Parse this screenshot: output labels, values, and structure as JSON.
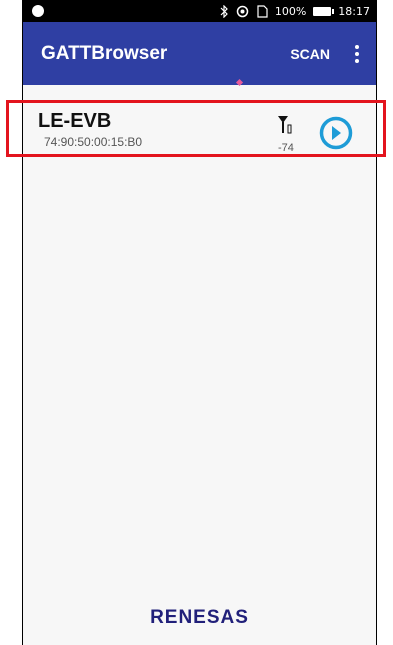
{
  "status_bar": {
    "battery_percent": "100%",
    "time": "18:17"
  },
  "app_bar": {
    "title": "GATTBrowser",
    "scan_label": "SCAN"
  },
  "devices": [
    {
      "name": "LE-EVB",
      "mac": "74:90:50:00:15:B0",
      "rssi": "-74"
    }
  ],
  "footer": {
    "logo_text": "RENESAS"
  },
  "colors": {
    "app_bar": "#2f3fa3",
    "connect_icon": "#1e9cd7",
    "highlight_box": "#e3141e",
    "logo": "#21207a"
  }
}
